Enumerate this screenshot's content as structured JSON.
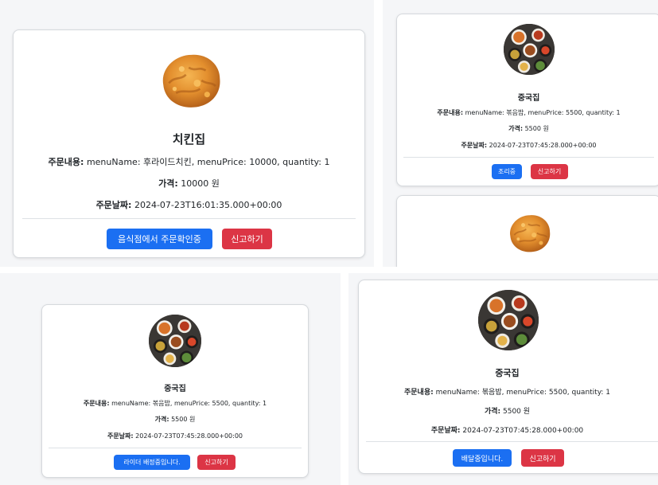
{
  "cards": {
    "big": {
      "name": "치킨집",
      "contents_label": "주문내용:",
      "contents": "menuName: 후라이드치킨, menuPrice: 10000, quantity: 1",
      "price_label": "가격:",
      "price": "10000 원",
      "date_label": "주문날짜:",
      "date": "2024-07-23T16:01:35.000+00:00",
      "status_button": "음식점에서 주문확인중",
      "report_button": "신고하기"
    },
    "topright": {
      "name": "중국집",
      "contents_label": "주문내용:",
      "contents": "menuName: 볶음밥, menuPrice: 5500, quantity: 1",
      "price_label": "가격:",
      "price": "5500 원",
      "date_label": "주문날짜:",
      "date": "2024-07-23T07:45:28.000+00:00",
      "status_button": "조리중",
      "report_button": "신고하기"
    },
    "bottomleft": {
      "name": "중국집",
      "contents_label": "주문내용:",
      "contents": "menuName: 볶음밥, menuPrice: 5500, quantity: 1",
      "price_label": "가격:",
      "price": "5500 원",
      "date_label": "주문날짜:",
      "date": "2024-07-23T07:45:28.000+00:00",
      "status_button": "라이더 배정중입니다.",
      "report_button": "신고하기"
    },
    "bottomright": {
      "name": "중국집",
      "contents_label": "주문내용:",
      "contents": "menuName: 볶음밥, menuPrice: 5500, quantity: 1",
      "price_label": "가격:",
      "price": "5500 원",
      "date_label": "주문날짜:",
      "date": "2024-07-23T07:45:28.000+00:00",
      "status_button": "배달중입니다.",
      "report_button": "신고하기"
    }
  },
  "images": {
    "chicken": "fried-chicken-image",
    "dishes": "chinese-food-dishes-image"
  },
  "colors": {
    "primary": "#1b6ff2",
    "danger": "#dc3545",
    "panel_bg": "#f5f6f8"
  }
}
